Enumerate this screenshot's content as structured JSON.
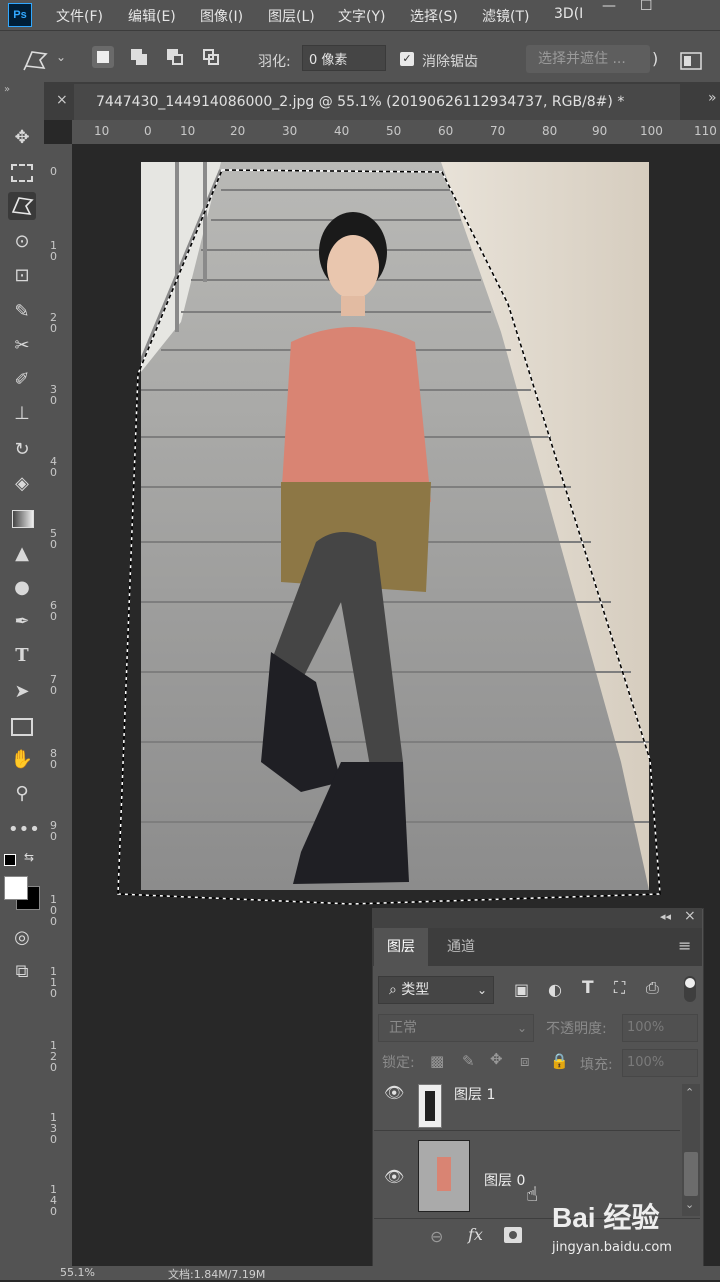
{
  "app": {
    "logo": "Ps"
  },
  "menu": [
    "文件(F)",
    "编辑(E)",
    "图像(I)",
    "图层(L)",
    "文字(Y)",
    "选择(S)",
    "滤镜(T)",
    "3D(I"
  ],
  "window_controls": [
    "—",
    "☐"
  ],
  "options": {
    "feather_label": "羽化:",
    "feather_value": "0 像素",
    "antialias_label": "消除锯齿",
    "antialias_checked": true,
    "select_mask_label": "选择并遮住 ..."
  },
  "document": {
    "tab_title": "7447430_144914086000_2.jpg @ 55.1% (20190626112934737, RGB/8#) *",
    "close_symbol": "×"
  },
  "rulers": {
    "top": [
      "10",
      "0",
      "10",
      "20",
      "30",
      "40",
      "50",
      "60",
      "70",
      "80",
      "90",
      "100",
      "110"
    ],
    "left": [
      "0",
      "1 0",
      "2 0",
      "3 0",
      "4 0",
      "5 0",
      "6 0",
      "7 0",
      "8 0",
      "9 0",
      "1 0 0",
      "1 1 0",
      "1 2 0",
      "1 3 0",
      "1 4 0"
    ]
  },
  "toolbar": [
    "move-icon",
    "marquee-icon",
    "polygonal-lasso-icon",
    "quick-select-icon",
    "crop-icon",
    "eyedropper-icon",
    "healing-brush-icon",
    "brush-icon",
    "stamp-icon",
    "history-brush-icon",
    "eraser-icon",
    "gradient-icon",
    "blur-icon",
    "dodge-icon",
    "pen-icon",
    "type-icon",
    "path-select-icon",
    "rectangle-icon",
    "hand-icon",
    "zoom-icon",
    "more-tools-icon"
  ],
  "layers_panel": {
    "tabs": [
      "图层",
      "通道"
    ],
    "kind_filter": "类型",
    "blend_mode": "正常",
    "opacity_label": "不透明度:",
    "opacity_value": "100%",
    "lock_label": "锁定:",
    "fill_label": "填充:",
    "fill_value": "100%",
    "layers": [
      {
        "name": "图层 1",
        "visible": true
      },
      {
        "name": "图层 0",
        "visible": true
      }
    ],
    "footer_icons": [
      "link-icon",
      "fx-icon",
      "mask-icon"
    ]
  },
  "status": {
    "zoom": "55.1%",
    "doc_size": "文档:1.84M/7.19M"
  },
  "watermark": {
    "brand": "Bai 经验",
    "url": "jingyan.baidu.com"
  }
}
